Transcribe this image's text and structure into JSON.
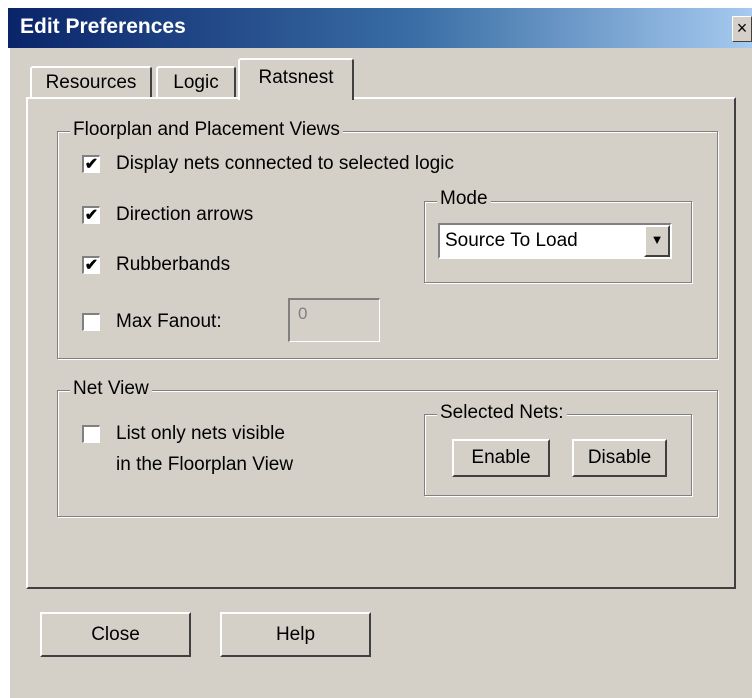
{
  "window": {
    "title": "Edit Preferences",
    "close_glyph": "×"
  },
  "tabs": [
    {
      "label": "Resources",
      "active": false
    },
    {
      "label": "Logic",
      "active": false
    },
    {
      "label": "Ratsnest",
      "active": true
    }
  ],
  "floorplan": {
    "legend": "Floorplan and Placement Views",
    "display_nets": {
      "label": "Display nets connected to selected logic",
      "checked": true
    },
    "direction_arrows": {
      "label": "Direction arrows",
      "checked": true
    },
    "rubberbands": {
      "label": "Rubberbands",
      "checked": true
    },
    "max_fanout": {
      "label": "Max Fanout:",
      "checked": false,
      "value": "0"
    },
    "mode": {
      "legend": "Mode",
      "selected": "Source To Load"
    }
  },
  "net_view": {
    "legend": "Net View",
    "list_only": {
      "line1": "List only nets visible",
      "line2": "in the Floorplan View",
      "checked": false
    },
    "selected_nets": {
      "legend": "Selected Nets:",
      "enable_label": "Enable",
      "disable_label": "Disable"
    }
  },
  "footer": {
    "close_label": "Close",
    "help_label": "Help"
  },
  "icons": {
    "check": "✔",
    "dropdown": "▼"
  }
}
